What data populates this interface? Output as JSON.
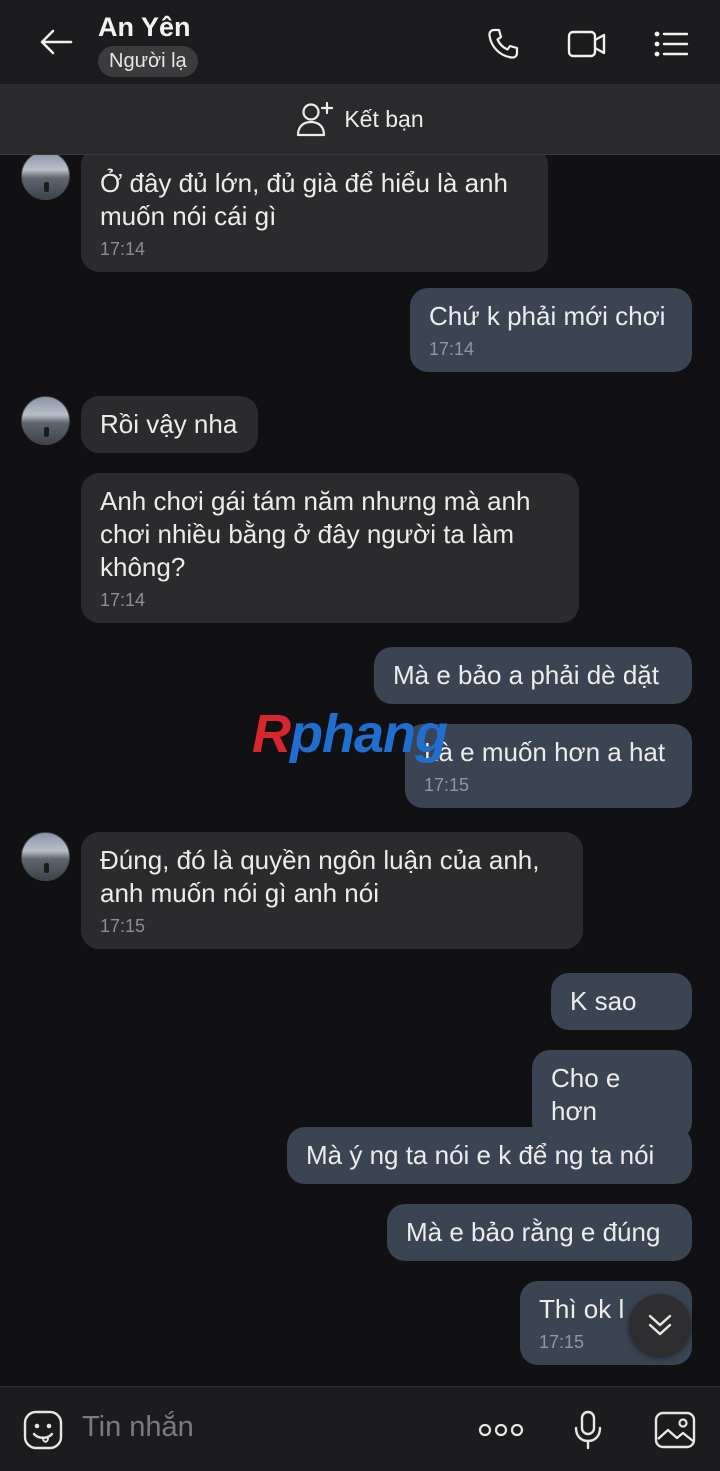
{
  "header": {
    "name": "An Yên",
    "badge": "Người lạ"
  },
  "add_friend": {
    "label": "Kết bạn"
  },
  "messages": [
    {
      "dir": "in",
      "text": "Ở đây đủ lớn, đủ già để hiểu là anh muốn nói cái gì",
      "time": "17:14"
    },
    {
      "dir": "out",
      "text": "Chứ k phải mới chơi",
      "time": "17:14"
    },
    {
      "dir": "in",
      "text": "Rồi vậy nha",
      "time": ""
    },
    {
      "dir": "in",
      "text": "Anh chơi gái tám năm nhưng mà anh chơi nhiều bằng ở đây người ta làm không?",
      "time": "17:14"
    },
    {
      "dir": "out",
      "text": "Mà e bảo a phải dè dặt",
      "time": ""
    },
    {
      "dir": "out",
      "text": "Là e muốn hơn a hat",
      "time": "17:15"
    },
    {
      "dir": "in",
      "text": "Đúng, đó là quyền ngôn luận của anh, anh muốn nói gì anh nói",
      "time": "17:15"
    },
    {
      "dir": "out",
      "text": "K sao",
      "time": ""
    },
    {
      "dir": "out",
      "text": "Cho e hơn",
      "time": ""
    },
    {
      "dir": "out",
      "text": "Mà ý ng ta nói e k để ng ta nói",
      "time": ""
    },
    {
      "dir": "out",
      "text": "Mà e bảo rằng e đúng",
      "time": ""
    },
    {
      "dir": "out",
      "text": "Thì ok l",
      "time": "17:15"
    }
  ],
  "watermark": {
    "first": "R",
    "rest": "phang"
  },
  "composer": {
    "placeholder": "Tin nhắn"
  },
  "colors": {
    "background": "#111113",
    "incoming_bubble": "#2b2b2d",
    "outgoing_bubble": "#3a4452",
    "header": "#1c1c1e"
  }
}
